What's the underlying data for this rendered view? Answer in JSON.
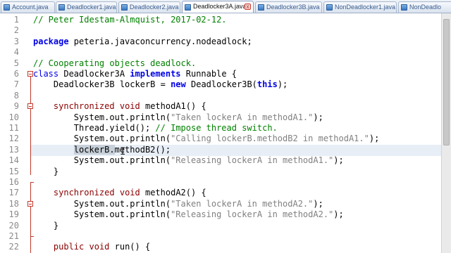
{
  "tabs": [
    {
      "label": "Account.java",
      "active": false
    },
    {
      "label": "Deadlocker1.java",
      "active": false
    },
    {
      "label": "Deadlocker2.java",
      "active": false
    },
    {
      "label": "Deadlocker3A.java",
      "active": true
    },
    {
      "label": "Deadlocker3B.java",
      "active": false
    },
    {
      "label": "NonDeadlocker1.java",
      "active": false
    },
    {
      "label": "NonDeadlo",
      "active": false
    }
  ],
  "close_glyph": "x",
  "editor": {
    "line_numbers": [
      "1",
      "2",
      "3",
      "4",
      "5",
      "6",
      "7",
      "8",
      "9",
      "10",
      "11",
      "12",
      "13",
      "14",
      "15",
      "16",
      "17",
      "18",
      "19",
      "20",
      "21",
      "22"
    ],
    "current_line": 13,
    "cursor_glyph": "I",
    "code": {
      "l1": "// Peter Idestam-Almquist, 2017-02-12.",
      "l3a": "package",
      "l3b": " peteria.javaconcurrency.nodeadlock;",
      "l5": "// Cooperating objects deadlock.",
      "l6a": "class",
      "l6b": " Deadlocker3A ",
      "l6c": "implements",
      "l6d": " Runnable {",
      "l7a": "    Deadlocker3B lockerB = ",
      "l7b": "new",
      "l7c": " Deadlocker3B(",
      "l7d": "this",
      "l7e": ");",
      "l9a": "    ",
      "l9b": "synchronized",
      "l9c": " ",
      "l9d": "void",
      "l9e": " methodA1() {",
      "l10a": "        System.out.println(",
      "l10b": "\"Taken lockerA in methodA1.\"",
      "l10c": ");",
      "l11a": "        Thread.yield(); ",
      "l11b": "// Impose thread switch.",
      "l12a": "        System.out.println(",
      "l12b": "\"Calling lockerB.methodB2 in methodA1.\"",
      "l12c": ");",
      "l13a": "        ",
      "l13b": "lockerB.",
      "l13c": "methodB2();",
      "l14a": "        System.out.println(",
      "l14b": "\"Releasing lockerA in methodA1.\"",
      "l14c": ");",
      "l15": "    }",
      "l17a": "    ",
      "l17b": "synchronized",
      "l17c": " ",
      "l17d": "void",
      "l17e": " methodA2() {",
      "l18a": "        System.out.println(",
      "l18b": "\"Taken lockerA in methodA2.\"",
      "l18c": ");",
      "l19a": "        System.out.println(",
      "l19b": "\"Releasing lockerA in methodA2.\"",
      "l19c": ");",
      "l20": "    }",
      "l22a": "    ",
      "l22b": "public",
      "l22c": " ",
      "l22d": "void",
      "l22e": " run() {"
    }
  },
  "colors": {
    "keyword": "#0000e6",
    "modifier": "#8b0000",
    "string": "#808080",
    "comment": "#008000",
    "current_line_bg": "#e8eef6",
    "selection_bg": "#c7cfd9"
  }
}
